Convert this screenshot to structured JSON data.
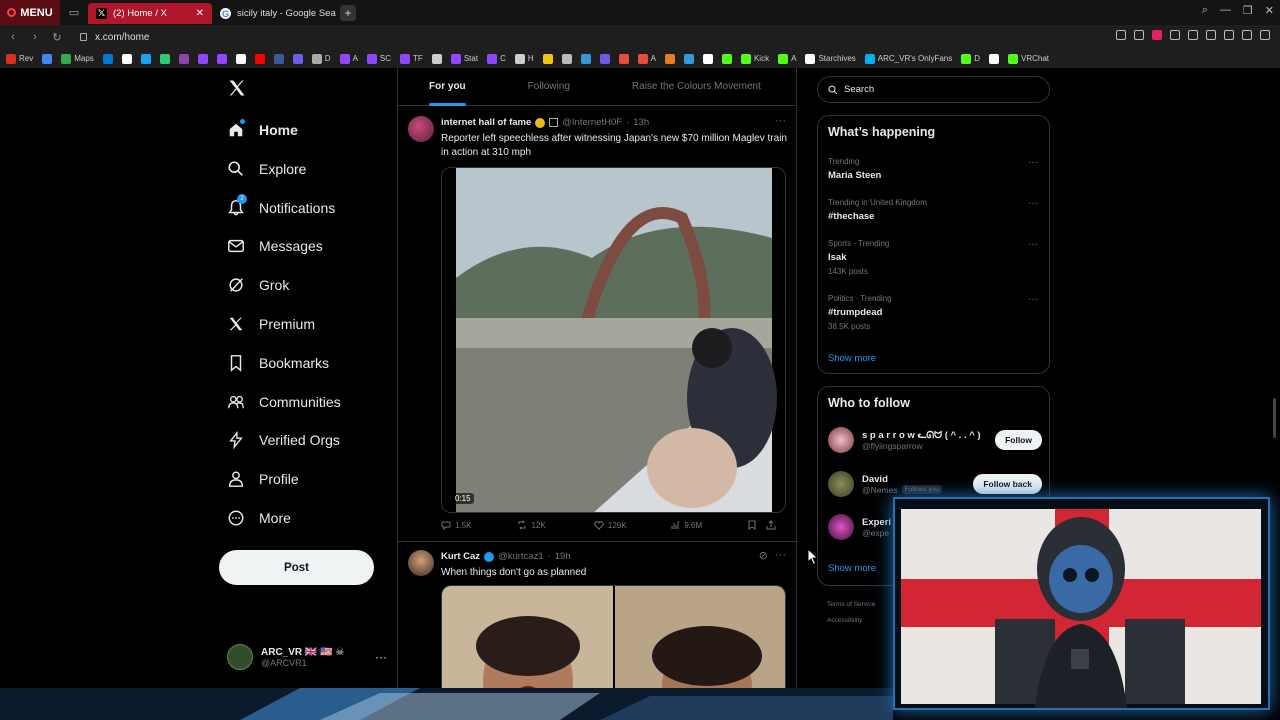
{
  "browser": {
    "menu_label": "MENU",
    "tabs": [
      {
        "title": "(2) Home / X",
        "active": true
      },
      {
        "title": "sicily italy - Google Searc",
        "active": false
      }
    ],
    "url": "x.com/home",
    "bookmarks": [
      {
        "label": "Rev",
        "color": "#d93025"
      },
      {
        "label": "",
        "color": "#4285f4"
      },
      {
        "label": "Maps",
        "color": "#34a853"
      },
      {
        "label": "",
        "color": "#0078d4"
      },
      {
        "label": "",
        "color": "#ffffff"
      },
      {
        "label": "",
        "color": "#1da1f2"
      },
      {
        "label": "",
        "color": "#2ecc71"
      },
      {
        "label": "",
        "color": "#8e44ad"
      },
      {
        "label": "",
        "color": "#9146ff"
      },
      {
        "label": "",
        "color": "#9146ff"
      },
      {
        "label": "",
        "color": "#ffffff"
      },
      {
        "label": "",
        "color": "#ff0000"
      },
      {
        "label": "",
        "color": "#3b5998"
      },
      {
        "label": "",
        "color": "#6c5ce7"
      },
      {
        "label": "D",
        "color": "#aaaaaa"
      },
      {
        "label": "A",
        "color": "#9146ff"
      },
      {
        "label": "SC",
        "color": "#9146ff"
      },
      {
        "label": "TF",
        "color": "#9146ff"
      },
      {
        "label": "",
        "color": "#cccccc"
      },
      {
        "label": "Stat",
        "color": "#9146ff"
      },
      {
        "label": "C",
        "color": "#9146ff"
      },
      {
        "label": "H",
        "color": "#cccccc"
      },
      {
        "label": "",
        "color": "#f1c40f"
      },
      {
        "label": "",
        "color": "#bbbbbb"
      },
      {
        "label": "",
        "color": "#3498db"
      },
      {
        "label": "",
        "color": "#6c5ce7"
      },
      {
        "label": "",
        "color": "#e74c3c"
      },
      {
        "label": "A",
        "color": "#e74c3c"
      },
      {
        "label": "",
        "color": "#e67e22"
      },
      {
        "label": "",
        "color": "#3498db"
      },
      {
        "label": "",
        "color": "#ffffff"
      },
      {
        "label": "",
        "color": "#53fc18"
      },
      {
        "label": "Kick",
        "color": "#53fc18"
      },
      {
        "label": "A",
        "color": "#53fc18"
      },
      {
        "label": "Starchives",
        "color": "#ffffff"
      },
      {
        "label": "ARC_VR's OnlyFans",
        "color": "#00aff0"
      },
      {
        "label": "D",
        "color": "#53fc18"
      },
      {
        "label": "",
        "color": "#ffffff"
      },
      {
        "label": "VRChat",
        "color": "#53fc18"
      }
    ]
  },
  "nav": {
    "items": [
      {
        "label": "Home",
        "icon": "home-icon",
        "active": true
      },
      {
        "label": "Explore",
        "icon": "search-icon"
      },
      {
        "label": "Notifications",
        "icon": "bell-icon",
        "badge": "2"
      },
      {
        "label": "Messages",
        "icon": "mail-icon"
      },
      {
        "label": "Grok",
        "icon": "grok-icon"
      },
      {
        "label": "Premium",
        "icon": "x-icon"
      },
      {
        "label": "Bookmarks",
        "icon": "bookmark-icon"
      },
      {
        "label": "Communities",
        "icon": "communities-icon"
      },
      {
        "label": "Verified Orgs",
        "icon": "lightning-icon"
      },
      {
        "label": "Profile",
        "icon": "person-icon"
      },
      {
        "label": "More",
        "icon": "more-circle-icon"
      }
    ],
    "post_label": "Post",
    "account": {
      "name": "ARC_VR 🇬🇧 🇺🇸 ☠",
      "handle": "@ARCVR1"
    }
  },
  "timeline": {
    "tabs": [
      "For you",
      "Following",
      "Raise the Colours Movement"
    ],
    "tweets": [
      {
        "name": "internet hall of fame",
        "handle": "@InternetH0F",
        "time": "13h",
        "text": "Reporter left speechless after witnessing Japan's new $70 million Maglev train in action at 310 mph",
        "video_time": "0:15",
        "replies": "1.5K",
        "reposts": "12K",
        "likes": "129K",
        "views": "9.6M"
      },
      {
        "name": "Kurt Caz",
        "handle": "@kurtcaz1",
        "time": "19h",
        "text": "When things don't go as planned"
      }
    ]
  },
  "sidebar": {
    "search_placeholder": "Search",
    "whats_happening_title": "What’s happening",
    "trends": [
      {
        "context": "Trending",
        "title": "Maria Steen",
        "count": ""
      },
      {
        "context": "Trending in United Kingdom",
        "title": "#thechase",
        "count": ""
      },
      {
        "context": "Sports · Trending",
        "title": "Isak",
        "count": "143K posts"
      },
      {
        "context": "Politics · Trending",
        "title": "#trumpdead",
        "count": "38.5K posts"
      }
    ],
    "show_more": "Show more",
    "who_to_follow_title": "Who to follow",
    "suggestions": [
      {
        "name": "s p a r r o w ᓚᘏᗢ ( ^ . . ^ ) ~...",
        "handle": "@flyiingsparrow",
        "button": "Follow",
        "follows_you": ""
      },
      {
        "name": "David",
        "handle": "@Nemes",
        "button": "Follow back",
        "follows_you": "Follows you"
      },
      {
        "name": "Experi",
        "handle": "@expe",
        "button": "",
        "follows_you": ""
      }
    ],
    "show_more_2": "Show more",
    "footer": [
      "Terms of Service",
      "Accessibility"
    ]
  }
}
